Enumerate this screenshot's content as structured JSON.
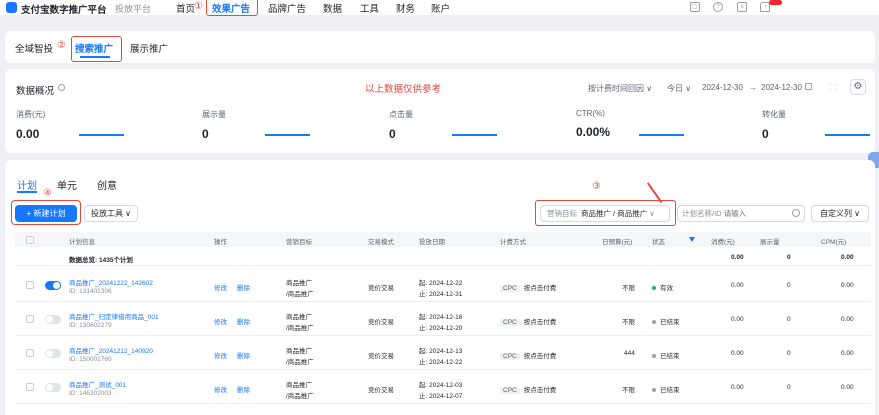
{
  "topnav": {
    "brand": "支付宝数字推广平台",
    "sub": "投放平台",
    "items": [
      "首页",
      "效果广告",
      "品牌广告",
      "数据",
      "工具",
      "财务",
      "账户"
    ],
    "marker": "①",
    "badge": "99+"
  },
  "subtabs": {
    "items": [
      "全域智投",
      "搜索推广",
      "展示推广"
    ],
    "marker": "②"
  },
  "overview": {
    "title": "数据概况",
    "note": "以上数据仅供参考",
    "granularity": "按计费时间回因",
    "quick": "今日",
    "date_from": "2024-12-30",
    "date_sep": "→",
    "date_to": "2024-12-30",
    "metrics": [
      {
        "label": "消费(元)",
        "value": "0.00"
      },
      {
        "label": "展示量",
        "value": "0"
      },
      {
        "label": "点击量",
        "value": "0"
      },
      {
        "label": "CTR(%)",
        "value": "0.00%"
      },
      {
        "label": "转化量",
        "value": "0"
      }
    ]
  },
  "plans": {
    "tabs": [
      "计划",
      "单元",
      "创意"
    ],
    "marker3": "③",
    "marker4": "④",
    "new_button": "+ 新建计划",
    "tool_button": "投放工具 ∨",
    "filter_label": "营销目标",
    "filter_value": "商品推广 / 商品推广",
    "search_label": "计划名称/ID",
    "search_placeholder": "请输入",
    "col_button": "自定义列 ∨",
    "headers": [
      "计划信息",
      "操作",
      "营销目标",
      "交易模式",
      "投放日期",
      "计费方式",
      "日预算(元)",
      "状态",
      "消费(元)",
      "展示量",
      "CPM(元)"
    ],
    "summary": {
      "label": "数据总览: 1435个计划",
      "cost": "0.00",
      "shows": "0",
      "cpm": "0.00"
    },
    "rows": [
      {
        "on": true,
        "name": "商品推广_20241222_142602",
        "id": "ID: 131401306",
        "edit": "修改",
        "del": "删除",
        "goal1": "商品推广",
        "goal2": "/商品推广",
        "mode": "竞价交易",
        "start": "起: 2024-12-22",
        "end": "止: 2024-12-31",
        "cpc": "CPC",
        "billing": "按点击付费",
        "budget": "不限",
        "status": "有效",
        "status_color": "#22b35e",
        "cost": "0.00",
        "shows": "0",
        "cpm": "0.00"
      },
      {
        "on": false,
        "name": "商品推广_归定律借用商品_001",
        "id": "ID: 130602279",
        "edit": "修改",
        "del": "删除",
        "goal1": "商品推广",
        "goal2": "/商品推广",
        "mode": "竞价交易",
        "start": "起: 2024-12-16",
        "end": "止: 2024-12-20",
        "cpc": "CPC",
        "billing": "按点击付费",
        "budget": "不限",
        "status": "已结束",
        "status_color": "#9aa0aa",
        "cost": "0.00",
        "shows": "0",
        "cpm": "0.00"
      },
      {
        "on": false,
        "name": "商品推广_20241212_140920",
        "id": "ID: 150001760",
        "edit": "修改",
        "del": "删除",
        "goal1": "商品推广",
        "goal2": "/商品推广",
        "mode": "竞价交易",
        "start": "起: 2024-12-13",
        "end": "止: 2024-12-22",
        "cpc": "CPC",
        "billing": "按点击付费",
        "budget": "444",
        "status": "已结束",
        "status_color": "#9aa0aa",
        "cost": "0.00",
        "shows": "0",
        "cpm": "0.00"
      },
      {
        "on": false,
        "name": "商品推广_测试_001",
        "id": "ID: 146302003",
        "edit": "修改",
        "del": "删除",
        "goal1": "商品推广",
        "goal2": "/商品推广",
        "mode": "竞价交易",
        "start": "起: 2024-12-03",
        "end": "止: 2024-12-07",
        "cpc": "CPC",
        "billing": "按点击付费",
        "budget": "不限",
        "status": "已结束",
        "status_color": "#9aa0aa",
        "cost": "0.00",
        "shows": "0",
        "cpm": "0.00"
      }
    ]
  }
}
